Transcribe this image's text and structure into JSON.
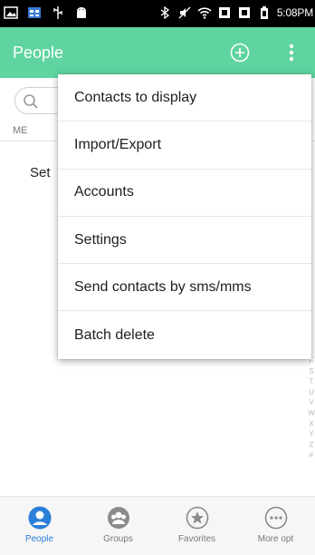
{
  "status_bar": {
    "time": "5:08PM",
    "icons": [
      "image-icon",
      "calendar-icon",
      "usb-icon",
      "android-icon",
      "bluetooth-icon",
      "mute-icon",
      "wifi-icon",
      "signal-icon",
      "signal-icon",
      "battery-icon"
    ]
  },
  "app_bar": {
    "title": "People",
    "accent_color": "#5fd3a0",
    "actions": [
      "add-icon",
      "overflow-menu-icon"
    ]
  },
  "contacts": {
    "search_icon": "search-icon",
    "section_label": "ME",
    "setup_text": "Set"
  },
  "index_letters": [
    "F",
    "S",
    "T",
    "U",
    "V",
    "W",
    "X",
    "Y",
    "Z",
    "#"
  ],
  "menu": {
    "items": [
      {
        "label": "Contacts to display"
      },
      {
        "label": "Import/Export"
      },
      {
        "label": "Accounts"
      },
      {
        "label": "Settings"
      },
      {
        "label": "Send contacts by sms/mms"
      },
      {
        "label": "Batch delete"
      }
    ]
  },
  "bottom_nav": {
    "active_color": "#2a7fd8",
    "tabs": [
      {
        "label": "People",
        "icon": "person-icon",
        "active": true
      },
      {
        "label": "Groups",
        "icon": "groups-icon",
        "active": false
      },
      {
        "label": "Favorites",
        "icon": "star-icon",
        "active": false
      },
      {
        "label": "More opt",
        "icon": "more-icon",
        "active": false
      }
    ]
  }
}
